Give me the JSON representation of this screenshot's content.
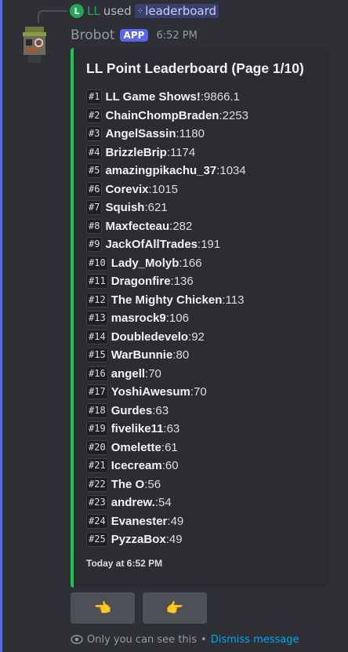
{
  "reply": {
    "user": "LL",
    "used_text": "used",
    "command": "leaderboard"
  },
  "message": {
    "author": "Brobot",
    "badge": "APP",
    "time": "6:52 PM"
  },
  "embed": {
    "title": "LL Point Leaderboard (Page 1/10)",
    "accent_color": "#23c552",
    "entries": [
      {
        "rank": "#1",
        "name": "LL Game Shows!",
        "points": "9866.1"
      },
      {
        "rank": "#2",
        "name": "ChainChompBraden",
        "points": "2253"
      },
      {
        "rank": "#3",
        "name": "AngelSassin",
        "points": "1180"
      },
      {
        "rank": "#4",
        "name": "BrizzleBrip",
        "points": "1174"
      },
      {
        "rank": "#5",
        "name": "amazingpikachu_37",
        "points": "1034"
      },
      {
        "rank": "#6",
        "name": "Corevix",
        "points": "1015"
      },
      {
        "rank": "#7",
        "name": "Squish",
        "points": "621"
      },
      {
        "rank": "#8",
        "name": "Maxfecteau",
        "points": "282"
      },
      {
        "rank": "#9",
        "name": "JackOfAllTrades",
        "points": "191"
      },
      {
        "rank": "#10",
        "name": "Lady_Molyb",
        "points": "166"
      },
      {
        "rank": "#11",
        "name": "Dragonfire",
        "points": "136"
      },
      {
        "rank": "#12",
        "name": "The Mighty Chicken",
        "points": "113"
      },
      {
        "rank": "#13",
        "name": "masrock9",
        "points": "106"
      },
      {
        "rank": "#14",
        "name": "Doubledevelo",
        "points": "92"
      },
      {
        "rank": "#15",
        "name": "WarBunnie",
        "points": "80"
      },
      {
        "rank": "#16",
        "name": "angell",
        "points": "70"
      },
      {
        "rank": "#17",
        "name": "YoshiAwesum",
        "points": "70"
      },
      {
        "rank": "#18",
        "name": "Gurdes",
        "points": "63"
      },
      {
        "rank": "#19",
        "name": "fivelike11",
        "points": "63"
      },
      {
        "rank": "#20",
        "name": "Omelette",
        "points": "61"
      },
      {
        "rank": "#21",
        "name": "Icecream",
        "points": "60"
      },
      {
        "rank": "#22",
        "name": "The O",
        "points": "56"
      },
      {
        "rank": "#23",
        "name": "andrew.",
        "points": "54"
      },
      {
        "rank": "#24",
        "name": "Evanester",
        "points": "49"
      },
      {
        "rank": "#25",
        "name": "PyzzaBox",
        "points": "49"
      }
    ],
    "footer": "Today at 6:52 PM"
  },
  "buttons": {
    "prev_icon": "point-left-icon",
    "prev_glyph": "👈",
    "next_icon": "point-right-icon",
    "next_glyph": "👉"
  },
  "ephemeral": {
    "text": "Only you can see this",
    "separator": "•",
    "dismiss": "Dismiss message"
  }
}
